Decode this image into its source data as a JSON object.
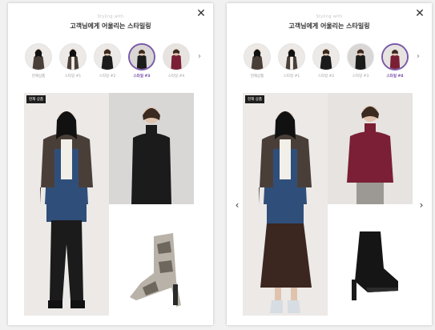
{
  "left_panel": {
    "subtitle": "Styling with",
    "title": "고객님에게 어울리는 스타일링",
    "close_icon": "✕",
    "tabs": [
      {
        "label": "현재상품",
        "selected": false
      },
      {
        "label": "스타일 #1",
        "selected": false
      },
      {
        "label": "스타일 #2",
        "selected": false
      },
      {
        "label": "스타일 #3",
        "selected": true
      },
      {
        "label": "스타일 #4",
        "selected": false
      }
    ],
    "tabs_next_icon": "›",
    "badge": "현재 상품"
  },
  "right_panel": {
    "subtitle": "Styling with",
    "title": "고객님에게 어울리는 스타일링",
    "close_icon": "✕",
    "tabs": [
      {
        "label": "현재상품",
        "selected": false
      },
      {
        "label": "스타일 #1",
        "selected": false
      },
      {
        "label": "스타일 #2",
        "selected": false
      },
      {
        "label": "스타일 #3",
        "selected": false
      },
      {
        "label": "스타일 #4",
        "selected": true
      }
    ],
    "tabs_next_icon": "›",
    "badge": "현재 상품",
    "prev_icon": "‹",
    "next_icon": "›"
  },
  "colors": {
    "accent": "#6a3fa0",
    "jacket": "#4a3f38",
    "denim": "#2f4f7a",
    "black": "#1b1b1b",
    "burgundy": "#7a1f35",
    "photo_bg": "#e6e3e0"
  },
  "icons": {
    "close": "close-icon",
    "tabs_next": "chevron-right-icon",
    "prev": "chevron-left-icon",
    "next": "chevron-right-icon"
  }
}
